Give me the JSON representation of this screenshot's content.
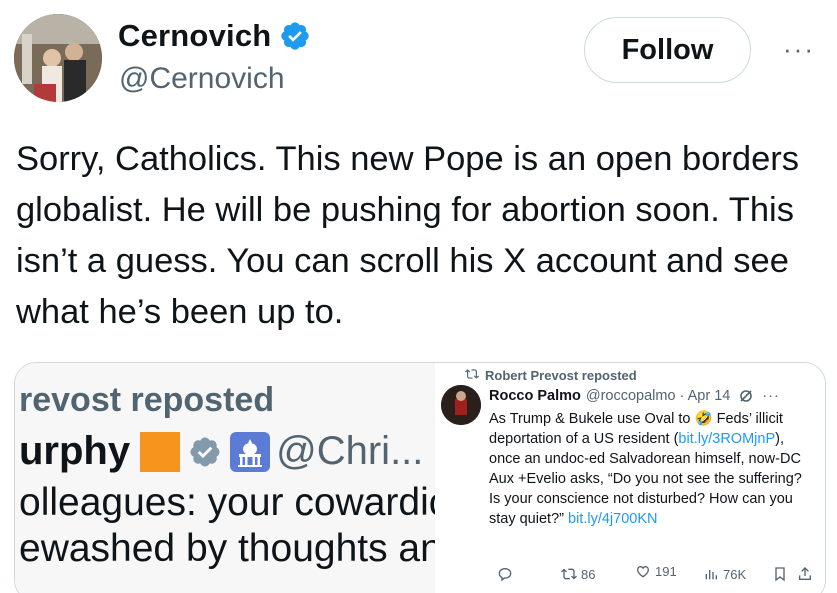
{
  "author": {
    "display_name": "Cernovich",
    "handle": "@Cernovich",
    "verified_icon": "verified-badge-icon"
  },
  "actions": {
    "follow_label": "Follow",
    "more_label": "···"
  },
  "tweet": {
    "text": "Sorry, Catholics. This new Pope is an open borders globalist. He will be pushing for abortion soon. This isn’t a guess. You can scroll his X account and see what he’s been up to."
  },
  "media_left": {
    "repost_text": "revost reposted",
    "name_fragment": "urphy",
    "handle_fragment": "@Chri... ·",
    "line1": "olleagues: your cowardic",
    "line2": "ewashed by thoughts an"
  },
  "media_right": {
    "repost_label": "Robert Prevost reposted",
    "author_name": "Rocco Palmo",
    "author_meta": "@roccopalmo · Apr 14",
    "body_parts": {
      "p1": "As Trump & Bukele use Oval to ",
      "emoji": "🤣",
      "p2": " Feds’ illicit deportation of a US resident (",
      "link1": "bit.ly/3ROMjnP",
      "p3": "), once an undoc-ed Salvadorean himself, now-DC Aux +Evelio asks, “Do you not see the suffering? Is your conscience not disturbed? How can you stay quiet?” ",
      "link2": "bit.ly/4j700KN"
    },
    "stats": {
      "reposts": "86",
      "likes": "191",
      "views": "76K"
    }
  },
  "colors": {
    "text_primary": "#0f1419",
    "text_secondary": "#536471",
    "link": "#1d9bf0",
    "verified": "#1d9bf0",
    "border": "#cfd9de"
  }
}
